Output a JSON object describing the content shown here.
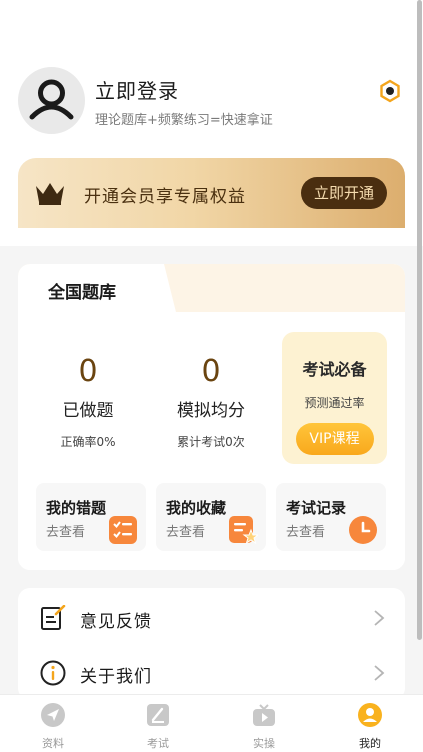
{
  "profile": {
    "login_title": "立即登录",
    "login_subtitle": "理论题库+频繁练习=快速拿证",
    "settings_icon": "hexagon-settings-icon",
    "avatar_icon": "user-silhouette-icon"
  },
  "vip": {
    "text": "开通会员享专属权益",
    "button": "立即开通",
    "icon": "crown-icon"
  },
  "question_bank": {
    "tab_label": "全国题库",
    "stats": [
      {
        "value": "0",
        "label": "已做题",
        "sub": "正确率0%"
      },
      {
        "value": "0",
        "label": "模拟均分",
        "sub": "累计考试0次"
      }
    ],
    "exam_box": {
      "title": "考试必备",
      "subtitle": "预测通过率",
      "button": "VIP课程"
    },
    "shortcuts": [
      {
        "title": "我的错题",
        "sub": "去查看",
        "icon": "mistakes-list-icon"
      },
      {
        "title": "我的收藏",
        "sub": "去查看",
        "icon": "favorites-star-icon"
      },
      {
        "title": "考试记录",
        "sub": "去查看",
        "icon": "clock-icon"
      }
    ]
  },
  "menu": [
    {
      "label": "意见反馈",
      "icon": "feedback-edit-icon"
    },
    {
      "label": "关于我们",
      "icon": "info-icon"
    }
  ],
  "tabbar": [
    {
      "label": "资料",
      "icon": "navigation-arrow-icon",
      "active": false
    },
    {
      "label": "考试",
      "icon": "exam-notebook-icon",
      "active": false
    },
    {
      "label": "实操",
      "icon": "video-tv-icon",
      "active": false
    },
    {
      "label": "我的",
      "icon": "profile-person-icon",
      "active": true
    }
  ],
  "colors": {
    "accent": "#f9a81c",
    "vip_dark": "#4a2e10",
    "stat_number": "#6a4410"
  }
}
